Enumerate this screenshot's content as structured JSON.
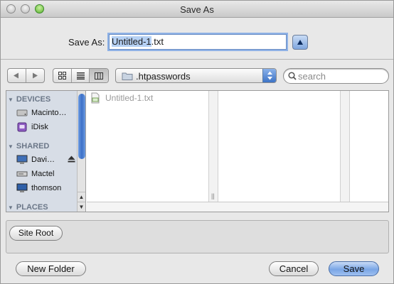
{
  "window": {
    "title": "Save As"
  },
  "save_as": {
    "label": "Save As:",
    "filename_selected": "Untitled-1",
    "filename_ext": ".txt"
  },
  "toolbar": {
    "back_icon": "back-arrow-icon",
    "forward_icon": "forward-arrow-icon",
    "views": [
      "icon-view-icon",
      "list-view-icon",
      "column-view-icon"
    ],
    "active_view": "column-view",
    "location": ".htpasswords",
    "search_placeholder": "search"
  },
  "sidebar": {
    "sections": [
      {
        "title": "DEVICES",
        "items": [
          {
            "label": "Macinto…",
            "icon": "hard-drive-icon"
          },
          {
            "label": "iDisk",
            "icon": "idisk-icon"
          }
        ]
      },
      {
        "title": "SHARED",
        "items": [
          {
            "label": "Davi…",
            "icon": "computer-icon",
            "eject": true
          },
          {
            "label": "Mactel",
            "icon": "server-icon"
          },
          {
            "label": "thomson",
            "icon": "computer-icon"
          }
        ]
      },
      {
        "title": "PLACES",
        "items": []
      }
    ]
  },
  "browser": {
    "files": [
      {
        "name": "Untitled-1.txt",
        "icon": "dw-document-icon"
      }
    ]
  },
  "accessory": {
    "site_root_label": "Site Root"
  },
  "buttons": {
    "new_folder": "New Folder",
    "cancel": "Cancel",
    "save": "Save"
  },
  "colors": {
    "accent": "#3d73c6",
    "sidebar_bg": "#d7dde6",
    "selection": "#b5d0f3"
  }
}
